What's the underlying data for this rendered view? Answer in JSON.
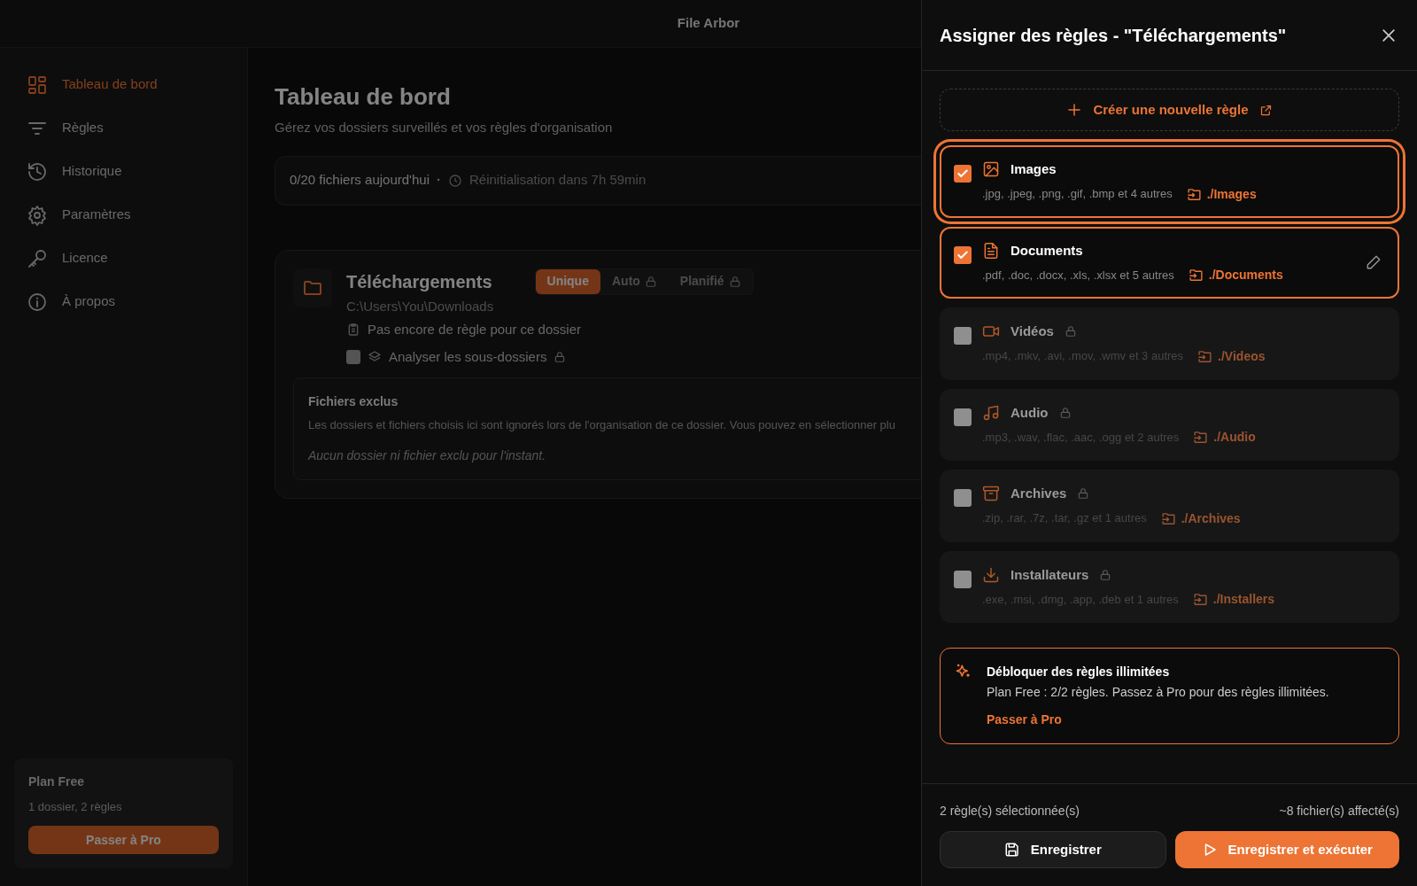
{
  "app": {
    "title": "File Arbor"
  },
  "sidebar": {
    "items": [
      {
        "label": "Tableau de bord",
        "kind": "dashboard",
        "selected": true
      },
      {
        "label": "Règles",
        "kind": "rules",
        "selected": false
      },
      {
        "label": "Historique",
        "kind": "history",
        "selected": false
      },
      {
        "label": "Paramètres",
        "kind": "settings",
        "selected": false
      },
      {
        "label": "Licence",
        "kind": "license",
        "selected": false
      },
      {
        "label": "À propos",
        "kind": "about",
        "selected": false
      }
    ],
    "plan": {
      "title": "Plan Free",
      "details": "1 dossier, 2 règles",
      "button": "Passer à Pro"
    }
  },
  "main": {
    "title": "Tableau de bord",
    "subtitle": "Gérez vos dossiers surveillés et vos règles d'organisation",
    "stats": {
      "files_today": "0/20 fichiers aujourd'hui",
      "separator": "·",
      "reset": "Réinitialisation dans 7h 59min"
    },
    "folder": {
      "name": "Téléchargements",
      "path": "C:\\Users\\You\\Downloads",
      "modes": [
        {
          "label": "Unique",
          "selected": true,
          "locked": false
        },
        {
          "label": "Auto",
          "selected": false,
          "locked": true
        },
        {
          "label": "Planifié",
          "selected": false,
          "locked": true
        }
      ],
      "rules_note": "Pas encore de règle pour ce dossier",
      "subfolders": {
        "label": "Analyser les sous-dossiers",
        "checked": false,
        "locked": true
      },
      "excluded": {
        "title": "Fichiers exclus",
        "description": "Les dossiers et fichiers choisis ici sont ignorés lors de l'organisation de ce dossier. Vous pouvez en sélectionner plu",
        "empty": "Aucun dossier ni fichier exclu pour l'instant."
      }
    }
  },
  "drawer": {
    "title": "Assigner des règles - \"Téléchargements\"",
    "create_rule": "Créer une nouvelle règle",
    "rules": [
      {
        "kind": "images",
        "name": "Images",
        "extensions": ".jpg, .jpeg, .png, .gif, .bmp et 4 autres",
        "destination": "./Images",
        "checked": true,
        "locked": false,
        "focused": true,
        "edit_button": false
      },
      {
        "kind": "documents",
        "name": "Documents",
        "extensions": ".pdf, .doc, .docx, .xls, .xlsx et 5 autres",
        "destination": "./Documents",
        "checked": true,
        "locked": false,
        "focused": false,
        "edit_button": true
      },
      {
        "kind": "videos",
        "name": "Vidéos",
        "extensions": ".mp4, .mkv, .avi, .mov, .wmv et 3 autres",
        "destination": "./Videos",
        "checked": false,
        "locked": true,
        "focused": false,
        "edit_button": false
      },
      {
        "kind": "audio",
        "name": "Audio",
        "extensions": ".mp3, .wav, .flac, .aac, .ogg et 2 autres",
        "destination": "./Audio",
        "checked": false,
        "locked": true,
        "focused": false,
        "edit_button": false
      },
      {
        "kind": "archives",
        "name": "Archives",
        "extensions": ".zip, .rar, .7z, .tar, .gz et 1 autres",
        "destination": "./Archives",
        "checked": false,
        "locked": true,
        "focused": false,
        "edit_button": false
      },
      {
        "kind": "installers",
        "name": "Installateurs",
        "extensions": ".exe, .msi, .dmg, .app, .deb et 1 autres",
        "destination": "./Installers",
        "checked": false,
        "locked": true,
        "focused": false,
        "edit_button": false
      }
    ],
    "upsell": {
      "title": "Débloquer des règles illimitées",
      "text": "Plan Free : 2/2 règles. Passez à Pro pour des règles illimitées.",
      "link": "Passer à Pro"
    },
    "footer": {
      "selected_count": "2 règle(s) sélectionnée(s)",
      "affected": "~8 fichier(s) affecté(s)",
      "save": "Enregistrer",
      "save_run": "Enregistrer et exécuter"
    }
  }
}
